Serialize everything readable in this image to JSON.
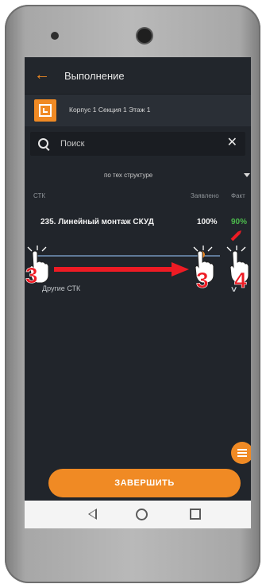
{
  "appbar": {
    "back_icon": "arrow-left-icon",
    "title": "Выполнение"
  },
  "location": {
    "icon": "plan-icon",
    "text": "Корпус 1 Секция 1 Этаж 1"
  },
  "search": {
    "icon": "search-icon",
    "placeholder": "Поиск",
    "clear_icon": "close-icon"
  },
  "filter": {
    "label": "по тех структуре"
  },
  "table": {
    "headers": {
      "name": "СТК",
      "declared": "Заявлено",
      "fact": "Факт"
    },
    "rows": [
      {
        "name": "235. Линейный монтаж СКУД",
        "declared": "100%",
        "fact": "90%",
        "progress_fraction": 0.9
      }
    ]
  },
  "other": {
    "label": "Другие СТК"
  },
  "actions": {
    "menu_icon": "menu-icon",
    "finish_label": "ЗАВЕРШИТЬ"
  },
  "annotations": {
    "step_left": "3",
    "step_mid": "3",
    "step_right": "4"
  },
  "colors": {
    "accent": "#f08a24",
    "fact_green": "#4cbb4c",
    "background": "#21252b",
    "annotation_red": "#ee1b24"
  }
}
